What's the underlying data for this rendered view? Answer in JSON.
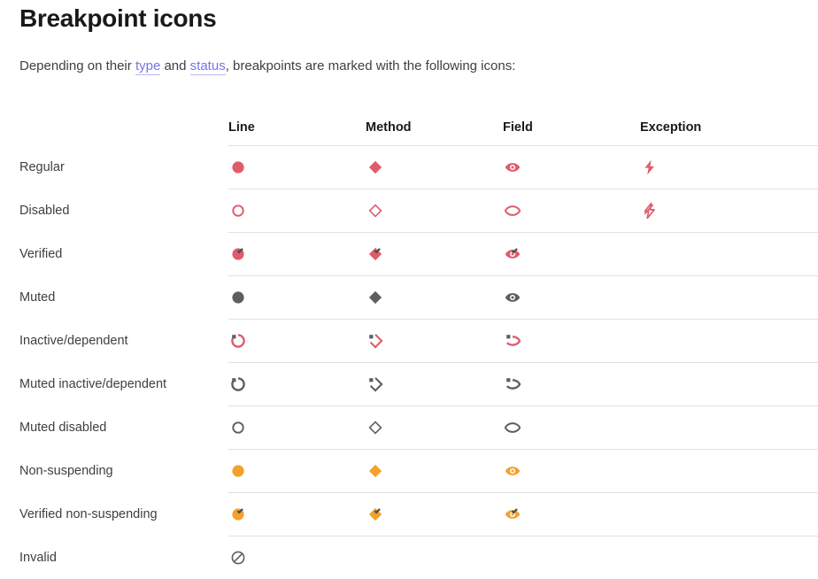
{
  "page": {
    "title": "Breakpoint icons",
    "intro": {
      "before": "Depending on their ",
      "link1": "type",
      "middle": " and ",
      "link2": "status",
      "after": ", breakpoints are marked with the following icons:"
    }
  },
  "colors": {
    "red": "#df5c6b",
    "orange": "#f4a02b",
    "gray": "#5c5f61",
    "check": "#4a4c4f",
    "rule": "#dfe1e5",
    "link": "#7674e8",
    "text": "#3c3f44",
    "heading": "#19191c"
  },
  "table": {
    "columns": [
      {
        "key": "label",
        "label": ""
      },
      {
        "key": "line",
        "label": "Line"
      },
      {
        "key": "method",
        "label": "Method"
      },
      {
        "key": "field",
        "label": "Field"
      },
      {
        "key": "exception",
        "label": "Exception"
      }
    ],
    "rows": [
      {
        "label": "Regular",
        "line": "circle-filled-red",
        "method": "diamond-filled-red",
        "field": "eye-filled-red",
        "exception": "lightning-filled-red"
      },
      {
        "label": "Disabled",
        "line": "circle-outline-red",
        "method": "diamond-outline-red",
        "field": "eye-outline-red",
        "exception": "lightning-slashed-red"
      },
      {
        "label": "Verified",
        "line": "circle-filled-red-check",
        "method": "diamond-filled-red-check",
        "field": "eye-filled-red-check",
        "exception": ""
      },
      {
        "label": "Muted",
        "line": "circle-filled-gray",
        "method": "diamond-filled-gray",
        "field": "eye-filled-gray",
        "exception": ""
      },
      {
        "label": "Inactive/dependent",
        "line": "circle-partial-red-dot",
        "method": "diamond-partial-red-dot",
        "field": "eye-partial-red-dot",
        "exception": ""
      },
      {
        "label": "Muted inactive/dependent",
        "line": "circle-partial-gray-dot",
        "method": "diamond-partial-gray-dot",
        "field": "eye-partial-gray-dot",
        "exception": ""
      },
      {
        "label": "Muted disabled",
        "line": "circle-outline-gray",
        "method": "diamond-outline-gray",
        "field": "eye-outline-gray",
        "exception": ""
      },
      {
        "label": "Non-suspending",
        "line": "circle-filled-orange",
        "method": "diamond-filled-orange",
        "field": "eye-filled-orange",
        "exception": ""
      },
      {
        "label": "Verified non-suspending",
        "line": "circle-filled-orange-check",
        "method": "diamond-filled-orange-check",
        "field": "eye-filled-orange-check",
        "exception": ""
      },
      {
        "label": "Invalid",
        "line": "circle-slashed-gray",
        "method": "",
        "field": "",
        "exception": ""
      }
    ]
  }
}
